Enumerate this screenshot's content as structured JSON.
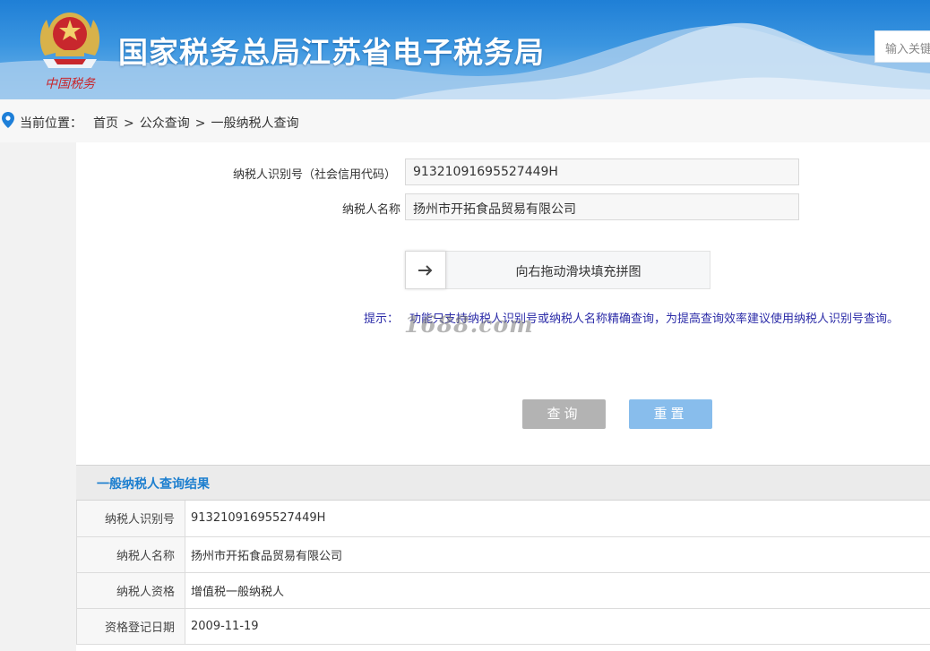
{
  "header": {
    "site_title": "国家税务总局江苏省电子税务局",
    "emblem_text": "中国税务",
    "search_placeholder": "输入关键"
  },
  "breadcrumb": {
    "prefix": "当前位置：",
    "items": [
      "首页",
      "公众查询",
      "一般纳税人查询"
    ],
    "separator": ">"
  },
  "form": {
    "id_label": "纳税人识别号（社会信用代码）",
    "id_value": "91321091695527449H",
    "name_label": "纳税人名称",
    "name_value": "扬州市开拓食品贸易有限公司",
    "slider_text": "向右拖动滑块填充拼图",
    "hint_prefix": "提示：",
    "hint_text": "功能只支持纳税人识别号或纳税人名称精确查询，为提高查询效率建议使用纳税人识别号查询。",
    "query_button": "查询",
    "reset_button": "重置"
  },
  "watermark": "1688.com",
  "result": {
    "title": "一般纳税人查询结果",
    "rows": [
      {
        "label": "纳税人识别号",
        "value": "91321091695527449H"
      },
      {
        "label": "纳税人名称",
        "value": "扬州市开拓食品贸易有限公司"
      },
      {
        "label": "纳税人资格",
        "value": "增值税一般纳税人"
      },
      {
        "label": "资格登记日期",
        "value": "2009-11-19"
      }
    ]
  },
  "colors": {
    "header_blue": "#2a86d8",
    "link_blue": "#1d7fcf",
    "hint_blue": "#2c2ca8",
    "query_button_gray": "#b3b3b3",
    "reset_button_blue": "#88bdec"
  },
  "icons": {
    "location": "location-pin-icon",
    "slider": "arrow-right-icon",
    "emblem": "tax-emblem-icon"
  }
}
